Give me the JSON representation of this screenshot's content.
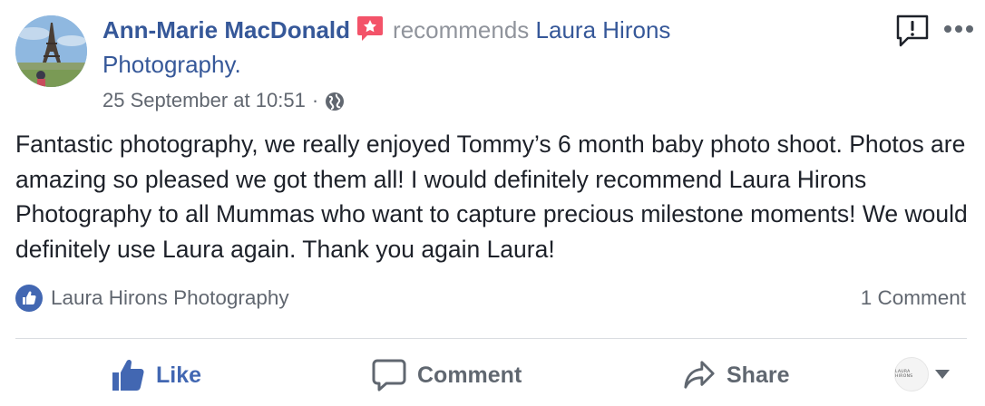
{
  "post": {
    "author": "Ann-Marie MacDonald",
    "action_text": "recommends",
    "page_name_line1": "Laura Hirons",
    "page_name_line2": "Photography.",
    "timestamp": "25 September at 10:51",
    "separator": "·",
    "privacy_icon": "globe-icon",
    "body": "Fantastic photography, we really enjoyed Tommy’s 6 month baby photo shoot. Photos are amazing so pleased we got them all! I would definitely recommend Laura Hirons Photography to all Mummas who want to capture precious milestone moments! We would definitely use Laura again. Thank you again Laura!"
  },
  "reactions": {
    "liked_by": "Laura Hirons Photography",
    "comment_count": "1 Comment"
  },
  "actions": {
    "like": "Like",
    "comment": "Comment",
    "share": "Share"
  },
  "page_switcher": {
    "avatar_text": "LAURA HIRONS"
  },
  "icons": {
    "recommend": "recommend-star-icon",
    "report": "report-icon",
    "more": "more-icon",
    "like_bubble": "like-bubble-icon",
    "like": "thumbs-up-icon",
    "comment": "comment-icon",
    "share": "share-icon",
    "caret": "caret-down-icon"
  },
  "colors": {
    "link": "#365899",
    "like_blue": "#4267b2",
    "recommend_red": "#f35369",
    "muted": "#616770"
  }
}
